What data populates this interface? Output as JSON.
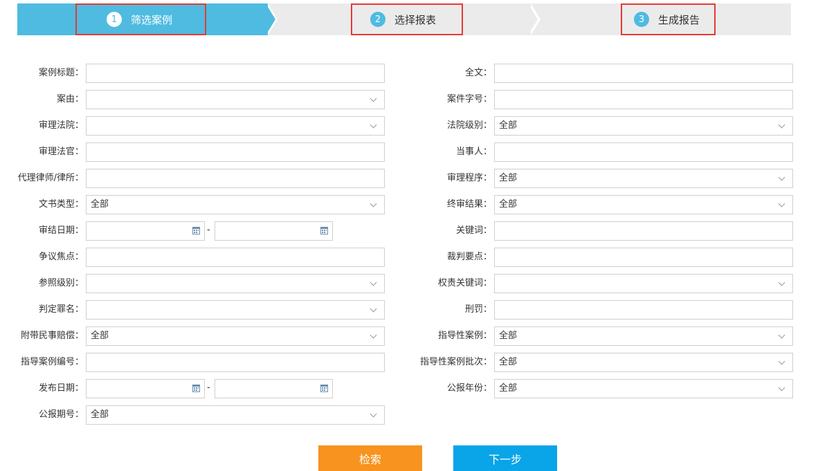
{
  "steps": [
    {
      "num": "1",
      "label": "筛选案例",
      "active": true
    },
    {
      "num": "2",
      "label": "选择报表",
      "active": false
    },
    {
      "num": "3",
      "label": "生成报告",
      "active": false
    }
  ],
  "colors": {
    "step_active": "#4fbbe0",
    "step_inactive": "#ebebeb",
    "highlight_border": "#e53935",
    "search_button": "#f7931e",
    "next_button": "#0aa4e8"
  },
  "left_fields": [
    {
      "label": "案例标题：",
      "type": "text",
      "value": ""
    },
    {
      "label": "案由：",
      "type": "select",
      "value": ""
    },
    {
      "label": "审理法院：",
      "type": "select",
      "value": ""
    },
    {
      "label": "审理法官：",
      "type": "text",
      "value": ""
    },
    {
      "label": "代理律师/律所：",
      "type": "text",
      "value": ""
    },
    {
      "label": "文书类型：",
      "type": "select",
      "value": "全部"
    },
    {
      "label": "审结日期：",
      "type": "daterange",
      "dash": "-"
    },
    {
      "label": "争议焦点：",
      "type": "text",
      "value": ""
    },
    {
      "label": "参照级别：",
      "type": "select",
      "value": ""
    },
    {
      "label": "判定罪名：",
      "type": "select",
      "value": ""
    },
    {
      "label": "附带民事赔偿：",
      "type": "select",
      "value": "全部"
    },
    {
      "label": "指导案例编号：",
      "type": "text",
      "value": ""
    },
    {
      "label": "发布日期：",
      "type": "daterange",
      "dash": "-"
    },
    {
      "label": "公报期号：",
      "type": "select",
      "value": "全部"
    }
  ],
  "right_fields": [
    {
      "label": "全文：",
      "type": "text",
      "value": ""
    },
    {
      "label": "案件字号：",
      "type": "text",
      "value": ""
    },
    {
      "label": "法院级别：",
      "type": "select",
      "value": "全部"
    },
    {
      "label": "当事人：",
      "type": "text",
      "value": ""
    },
    {
      "label": "审理程序：",
      "type": "select",
      "value": "全部"
    },
    {
      "label": "终审结果：",
      "type": "select",
      "value": "全部"
    },
    {
      "label": "关键词：",
      "type": "text",
      "value": ""
    },
    {
      "label": "裁判要点：",
      "type": "text",
      "value": ""
    },
    {
      "label": "权责关键词：",
      "type": "select",
      "value": ""
    },
    {
      "label": "刑罚：",
      "type": "text",
      "value": ""
    },
    {
      "label": "指导性案例：",
      "type": "select",
      "value": "全部"
    },
    {
      "label": "指导性案例批次：",
      "type": "select",
      "value": "全部"
    },
    {
      "label": "公报年份：",
      "type": "select",
      "value": "全部"
    }
  ],
  "buttons": {
    "search_label": "检索",
    "next_label": "下一步"
  }
}
